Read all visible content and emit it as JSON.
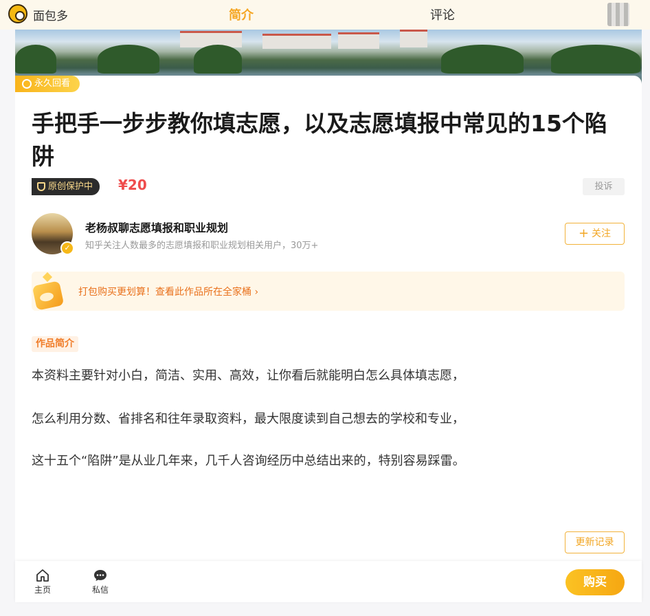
{
  "header": {
    "brand": "面包多",
    "tabs": [
      {
        "label": "简介",
        "active": true
      },
      {
        "label": "评论",
        "active": false
      }
    ]
  },
  "product": {
    "replay_badge": "永久回看",
    "title": "手把手一步步教你填志愿，以及志愿填报中常见的15个陷阱",
    "protection_badge": "原创保护中",
    "price": "¥20",
    "report_label": "投诉"
  },
  "author": {
    "name": "老杨叔聊志愿填报和职业规划",
    "description": "知乎关注人数最多的志愿填报和职业规划相关用户，30万+",
    "follow_label": "关注",
    "verified": true
  },
  "promo": {
    "text": "打包购买更划算！查看此作品所在全家桶",
    "chevron": "›"
  },
  "intro": {
    "label": "作品简介",
    "paragraphs": [
      "本资料主要针对小白，简洁、实用、高效，让你看后就能明白怎么具体填志愿，",
      "怎么利用分数、省排名和往年录取资料，最大限度读到自己想去的学校和专业，",
      "这十五个“陷阱”是从业几年来，几千人咨询经历中总结出来的，特别容易踩雷。"
    ],
    "history_label": "更新记录"
  },
  "bottom_nav": {
    "home_label": "主页",
    "message_label": "私信",
    "buy_label": "购买"
  },
  "colors": {
    "accent": "#f5a623",
    "price": "#ef4d4d",
    "promo_text": "#e9711c",
    "header_bg": "#fdf8ec"
  }
}
